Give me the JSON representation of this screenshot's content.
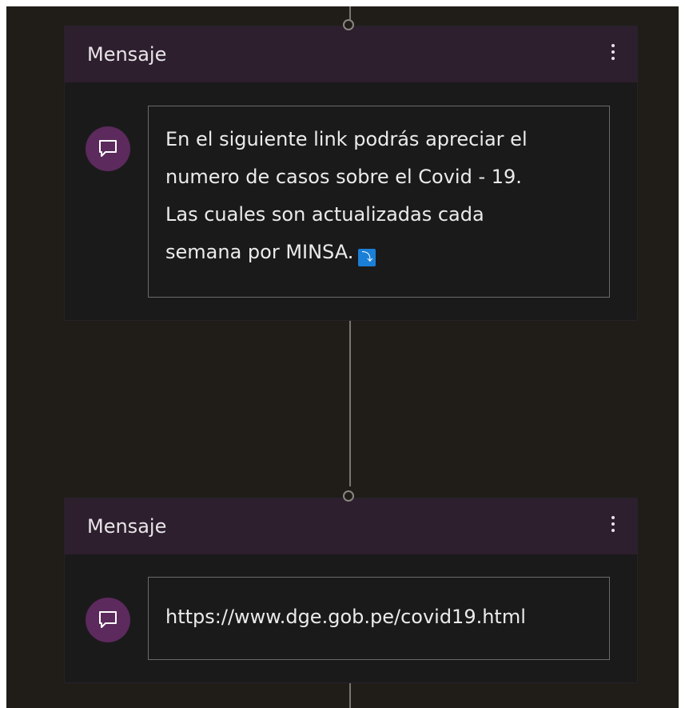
{
  "nodes": [
    {
      "title": "Mensaje",
      "more_icon": "more-vertical-icon",
      "node_icon": "chat-bubble-icon",
      "message_lines": [
        "En el siguiente link podrás apreciar el",
        "numero de casos sobre el Covid - 19.",
        "Las cuales son actualizadas cada",
        "semana por MINSA."
      ],
      "emoji": "⤵",
      "emoji_name": "arrow-down-emoji"
    },
    {
      "title": "Mensaje",
      "more_icon": "more-vertical-icon",
      "node_icon": "chat-bubble-icon",
      "message_lines": [
        "https://www.dge.gob.pe/covid19.html"
      ]
    }
  ],
  "colors": {
    "canvas": "#201c18",
    "header": "#2d1f2d",
    "card_body": "#1b1a1b",
    "icon_circle": "#5c2a5c",
    "connector": "#7a7570",
    "emoji_badge": "#1a7fd6"
  }
}
